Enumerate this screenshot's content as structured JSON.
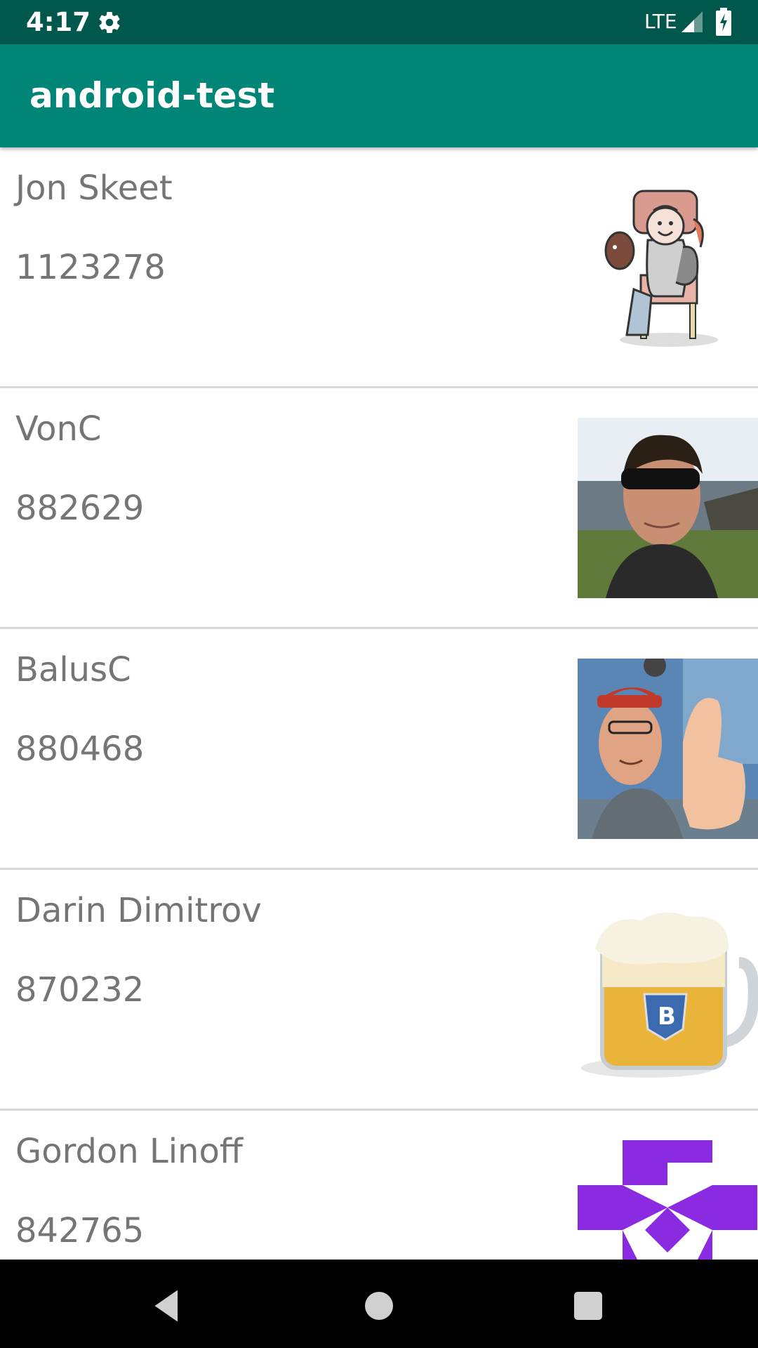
{
  "status_bar": {
    "time": "4:17",
    "network": "LTE"
  },
  "app_bar": {
    "title": "android-test"
  },
  "users": [
    {
      "name": "Jon Skeet",
      "reputation": "1123278",
      "avatar": "cartoon-avatar"
    },
    {
      "name": "VonC",
      "reputation": "882629",
      "avatar": "photo-sunglasses-avatar"
    },
    {
      "name": "BalusC",
      "reputation": "880468",
      "avatar": "photo-thumbs-up-avatar"
    },
    {
      "name": "Darin Dimitrov",
      "reputation": "870232",
      "avatar": "beer-mug-avatar"
    },
    {
      "name": "Gordon Linoff",
      "reputation": "842765",
      "avatar": "identicon-avatar"
    }
  ],
  "colors": {
    "status_bar": "#00574b",
    "app_bar": "#008577",
    "text_secondary": "#757575",
    "identicon": "#8a2be2"
  },
  "nav_bar": {
    "icons": [
      "back-icon",
      "home-icon",
      "recents-icon"
    ]
  }
}
